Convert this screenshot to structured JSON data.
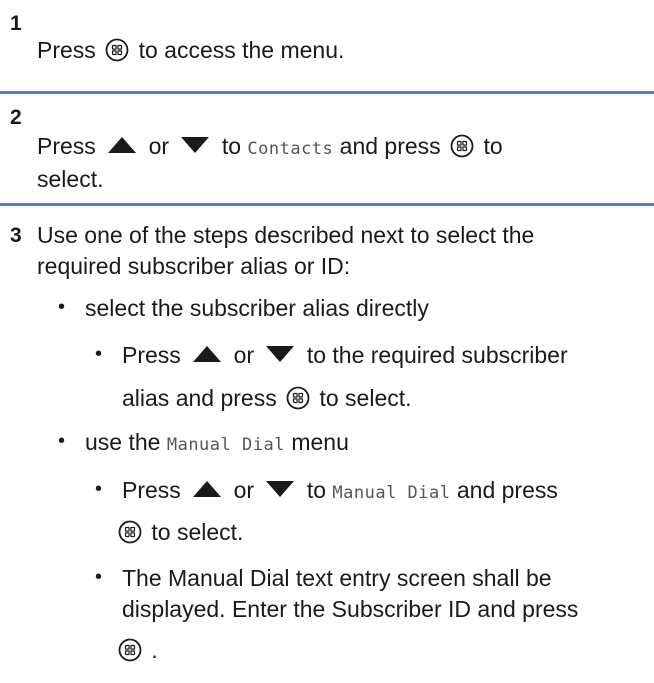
{
  "steps": [
    {
      "number": "1",
      "lines": [
        {
          "pre": "Press",
          "post": "to access the menu."
        }
      ]
    },
    {
      "number": "2",
      "line1": {
        "pre": "Press",
        "or": "or",
        "to": "to",
        "menu_item": "Contacts",
        "and_press": "and press",
        "post": "to"
      },
      "line2": "select."
    },
    {
      "number": "3",
      "intro_line1": "Use one of the steps described next to select the",
      "intro_line2": "required subscriber alias or ID:",
      "options": [
        {
          "label": "select the subscriber alias directly",
          "substeps": [
            {
              "line1": {
                "pre": "Press",
                "or": "or",
                "post": "to the required subscriber"
              },
              "line2": {
                "pre": "alias and press",
                "post": "to select."
              }
            }
          ]
        },
        {
          "label_pre": "use the",
          "label_menu": "Manual Dial",
          "label_post": "menu",
          "substeps": [
            {
              "line1": {
                "pre": "Press",
                "or": "or",
                "to": "to",
                "menu_item": "Manual Dial",
                "post": "and press"
              },
              "line2": {
                "post": "to select."
              }
            },
            {
              "line1": "The Manual Dial text entry screen shall be",
              "line2": "displayed. Enter the Subscriber ID and press",
              "line3_post": "."
            }
          ]
        }
      ]
    }
  ],
  "bullet_char": "•",
  "icons": {
    "menu_button": "menu-ok-button-icon",
    "up": "up-arrow-icon",
    "down": "down-arrow-icon"
  },
  "colors": {
    "rule": "#4a86b8",
    "text": "#1a1a1a",
    "menu_text": "#555555"
  }
}
